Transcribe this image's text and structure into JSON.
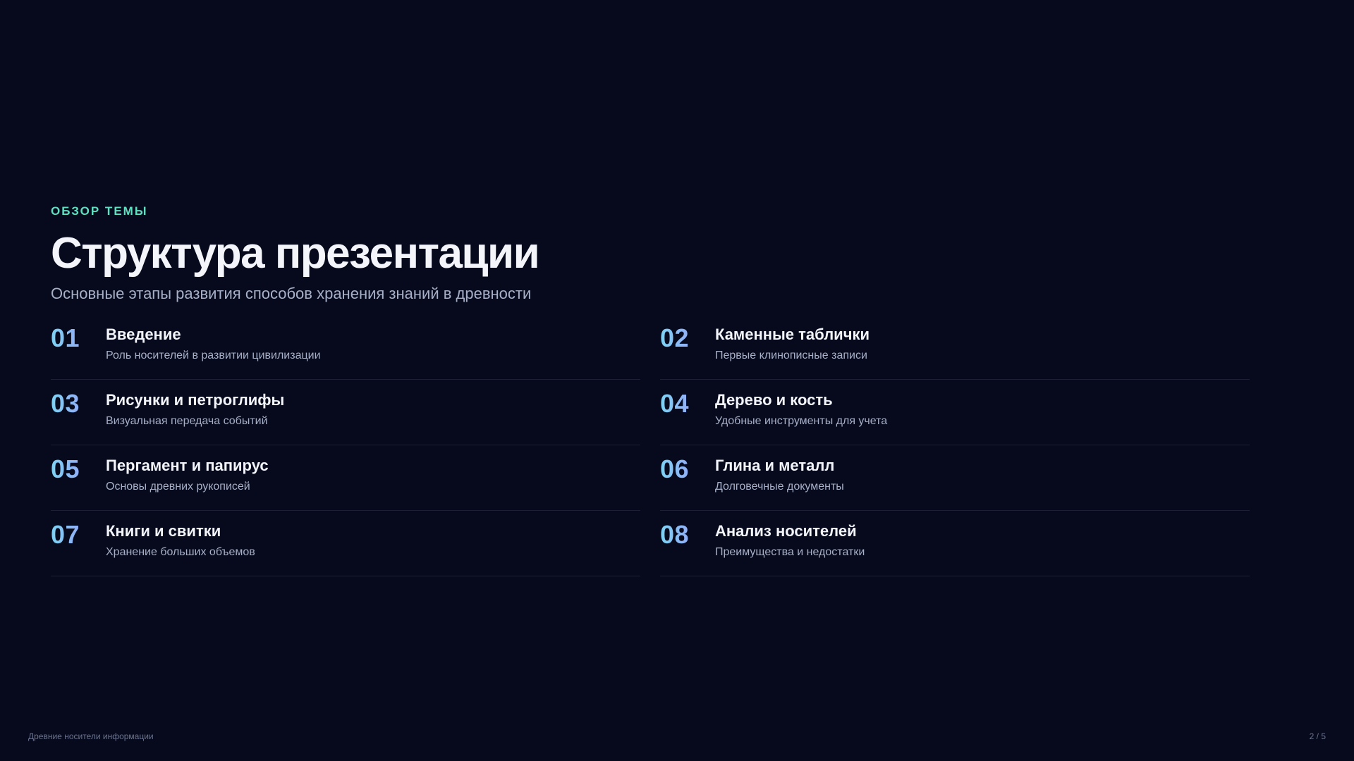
{
  "header": {
    "eyebrow": "ОБЗОР ТЕМЫ",
    "title": "Структура презентации",
    "subtitle": "Основные этапы развития способов хранения знаний в древности"
  },
  "agenda": {
    "items": [
      {
        "number": "01",
        "title": "Введение",
        "description": "Роль носителей в развитии цивилизации"
      },
      {
        "number": "02",
        "title": "Каменные таблички",
        "description": "Первые клинописные записи"
      },
      {
        "number": "03",
        "title": "Рисунки и петроглифы",
        "description": "Визуальная передача событий"
      },
      {
        "number": "04",
        "title": "Дерево и кость",
        "description": "Удобные инструменты для учета"
      },
      {
        "number": "05",
        "title": "Пергамент и папирус",
        "description": "Основы древних рукописей"
      },
      {
        "number": "06",
        "title": "Глина и металл",
        "description": "Долговечные документы"
      },
      {
        "number": "07",
        "title": "Книги и свитки",
        "description": "Хранение больших объемов"
      },
      {
        "number": "08",
        "title": "Анализ носителей",
        "description": "Преимущества и недостатки"
      }
    ]
  },
  "footer": {
    "presentation_title": "Древние носители информации",
    "page_indicator": "2 / 5"
  },
  "colors": {
    "background": "#070a1c",
    "accent": "#5fe0c0",
    "number_gradient_start": "#7dd3f5",
    "number_gradient_end": "#a58cf7"
  }
}
